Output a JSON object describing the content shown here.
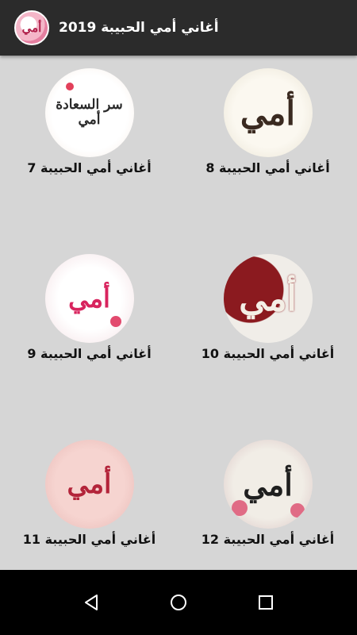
{
  "app": {
    "title": "أغاني أمي الحبيبة 2019",
    "icon_text": "أمي"
  },
  "grid": {
    "items": [
      {
        "label": "أغاني أمي الحبيبة 7",
        "thumb_text": "سر السعادة أمي"
      },
      {
        "label": "أغاني أمي الحبيبة 8",
        "thumb_text": "أمي"
      },
      {
        "label": "أغاني أمي الحبيبة 9",
        "thumb_text": "أمي"
      },
      {
        "label": "أغاني أمي الحبيبة 10",
        "thumb_text": "أمي"
      },
      {
        "label": "أغاني أمي الحبيبة 11",
        "thumb_text": "أمي"
      },
      {
        "label": "أغاني أمي الحبيبة 12",
        "thumb_text": "أمي"
      }
    ]
  },
  "navbar": {
    "icons": [
      "back-icon",
      "home-icon",
      "recents-icon"
    ]
  },
  "colors": {
    "appbar": "#2b2b2b",
    "background": "#d6d6d6",
    "navbar": "#000000"
  }
}
